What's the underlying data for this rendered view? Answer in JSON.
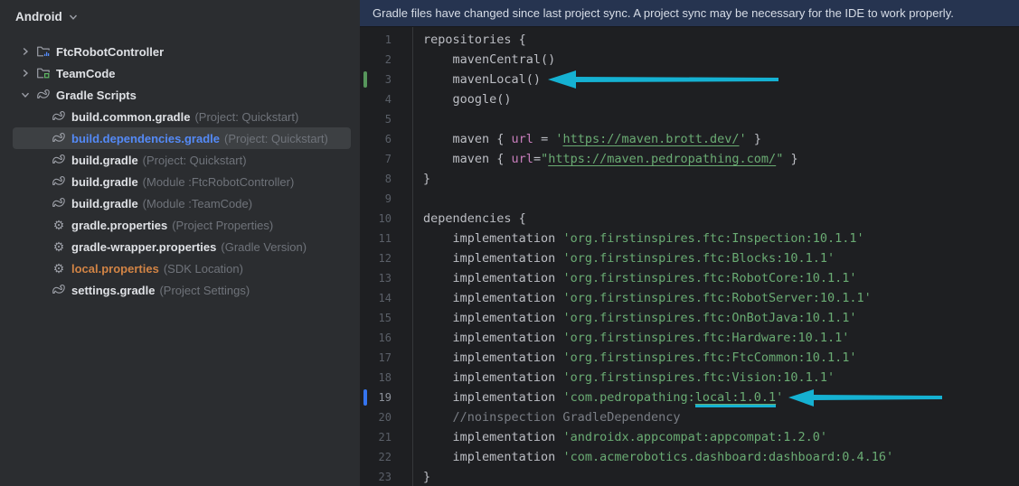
{
  "colors": {
    "accent_arrow": "#15b1d2",
    "banner_bg": "#263450",
    "selected_file": "#548af7",
    "sdk_location_file": "#d28445",
    "string_green": "#6aab73",
    "url_key_purple": "#c77dbb",
    "comment_gray": "#7a7e85",
    "added_marker_green": "#57965c",
    "changed_marker_blue": "#3574f0"
  },
  "sidebar": {
    "title": "Android",
    "items": [
      {
        "label": "FtcRobotController",
        "annotation": "",
        "icon": "android-folder",
        "chevron": "right",
        "level": 0,
        "selected": false,
        "color": ""
      },
      {
        "label": "TeamCode",
        "annotation": "",
        "icon": "code-folder",
        "chevron": "right",
        "level": 0,
        "selected": false,
        "color": ""
      },
      {
        "label": "Gradle Scripts",
        "annotation": "",
        "icon": "gradle",
        "chevron": "down",
        "level": 0,
        "selected": false,
        "color": ""
      },
      {
        "label": "build.common.gradle",
        "annotation": "(Project: Quickstart)",
        "icon": "gradle",
        "chevron": "",
        "level": 1,
        "selected": false,
        "color": ""
      },
      {
        "label": "build.dependencies.gradle",
        "annotation": "(Project: Quickstart)",
        "icon": "gradle",
        "chevron": "",
        "level": 1,
        "selected": true,
        "color": "blue"
      },
      {
        "label": "build.gradle",
        "annotation": "(Project: Quickstart)",
        "icon": "gradle",
        "chevron": "",
        "level": 1,
        "selected": false,
        "color": ""
      },
      {
        "label": "build.gradle",
        "annotation": "(Module :FtcRobotController)",
        "icon": "gradle",
        "chevron": "",
        "level": 1,
        "selected": false,
        "color": ""
      },
      {
        "label": "build.gradle",
        "annotation": "(Module :TeamCode)",
        "icon": "gradle",
        "chevron": "",
        "level": 1,
        "selected": false,
        "color": ""
      },
      {
        "label": "gradle.properties",
        "annotation": "(Project Properties)",
        "icon": "gear",
        "chevron": "",
        "level": 1,
        "selected": false,
        "color": ""
      },
      {
        "label": "gradle-wrapper.properties",
        "annotation": "(Gradle Version)",
        "icon": "gear",
        "chevron": "",
        "level": 1,
        "selected": false,
        "color": ""
      },
      {
        "label": "local.properties",
        "annotation": "(SDK Location)",
        "icon": "gear",
        "chevron": "",
        "level": 1,
        "selected": false,
        "color": "orange"
      },
      {
        "label": "settings.gradle",
        "annotation": "(Project Settings)",
        "icon": "gradle",
        "chevron": "",
        "level": 1,
        "selected": false,
        "color": ""
      }
    ]
  },
  "banner": {
    "text": "Gradle files have changed since last project sync. A project sync may be necessary for the IDE to work properly."
  },
  "editor": {
    "lines": [
      {
        "n": "1",
        "seg": [
          [
            "plain",
            "repositories {"
          ]
        ],
        "marker": "",
        "active": false
      },
      {
        "n": "2",
        "seg": [
          [
            "plain",
            "    mavenCentral()"
          ]
        ],
        "marker": "",
        "active": false
      },
      {
        "n": "3",
        "seg": [
          [
            "plain",
            "    mavenLocal()"
          ]
        ],
        "marker": "added",
        "active": false
      },
      {
        "n": "4",
        "seg": [
          [
            "plain",
            "    google()"
          ]
        ],
        "marker": "",
        "active": false
      },
      {
        "n": "5",
        "seg": [],
        "marker": "",
        "active": false
      },
      {
        "n": "6",
        "seg": [
          [
            "plain",
            "    maven { "
          ],
          [
            "prop",
            "url"
          ],
          [
            "plain",
            " = "
          ],
          [
            "string",
            "'"
          ],
          [
            "link",
            "https://maven.brott.dev/"
          ],
          [
            "string",
            "'"
          ],
          [
            "plain",
            " }"
          ]
        ],
        "marker": "",
        "active": false
      },
      {
        "n": "7",
        "seg": [
          [
            "plain",
            "    maven { "
          ],
          [
            "prop",
            "url"
          ],
          [
            "plain",
            "="
          ],
          [
            "string",
            "\""
          ],
          [
            "link",
            "https://maven.pedropathing.com/"
          ],
          [
            "string",
            "\""
          ],
          [
            "plain",
            " }"
          ]
        ],
        "marker": "",
        "active": false
      },
      {
        "n": "8",
        "seg": [
          [
            "plain",
            "}"
          ]
        ],
        "marker": "",
        "active": false
      },
      {
        "n": "9",
        "seg": [],
        "marker": "",
        "active": false
      },
      {
        "n": "10",
        "seg": [
          [
            "plain",
            "dependencies {"
          ]
        ],
        "marker": "",
        "active": false
      },
      {
        "n": "11",
        "seg": [
          [
            "plain",
            "    implementation "
          ],
          [
            "string",
            "'org.firstinspires.ftc:Inspection:10.1.1'"
          ]
        ],
        "marker": "",
        "active": false
      },
      {
        "n": "12",
        "seg": [
          [
            "plain",
            "    implementation "
          ],
          [
            "string",
            "'org.firstinspires.ftc:Blocks:10.1.1'"
          ]
        ],
        "marker": "",
        "active": false
      },
      {
        "n": "13",
        "seg": [
          [
            "plain",
            "    implementation "
          ],
          [
            "string",
            "'org.firstinspires.ftc:RobotCore:10.1.1'"
          ]
        ],
        "marker": "",
        "active": false
      },
      {
        "n": "14",
        "seg": [
          [
            "plain",
            "    implementation "
          ],
          [
            "string",
            "'org.firstinspires.ftc:RobotServer:10.1.1'"
          ]
        ],
        "marker": "",
        "active": false
      },
      {
        "n": "15",
        "seg": [
          [
            "plain",
            "    implementation "
          ],
          [
            "string",
            "'org.firstinspires.ftc:OnBotJava:10.1.1'"
          ]
        ],
        "marker": "",
        "active": false
      },
      {
        "n": "16",
        "seg": [
          [
            "plain",
            "    implementation "
          ],
          [
            "string",
            "'org.firstinspires.ftc:Hardware:10.1.1'"
          ]
        ],
        "marker": "",
        "active": false
      },
      {
        "n": "17",
        "seg": [
          [
            "plain",
            "    implementation "
          ],
          [
            "string",
            "'org.firstinspires.ftc:FtcCommon:10.1.1'"
          ]
        ],
        "marker": "",
        "active": false
      },
      {
        "n": "18",
        "seg": [
          [
            "plain",
            "    implementation "
          ],
          [
            "string",
            "'org.firstinspires.ftc:Vision:10.1.1'"
          ]
        ],
        "marker": "",
        "active": false
      },
      {
        "n": "19",
        "seg": [
          [
            "plain",
            "    implementation "
          ],
          [
            "string",
            "'com.pedropathing:"
          ],
          [
            "linkann",
            "local:1.0.1"
          ],
          [
            "string",
            "'"
          ]
        ],
        "marker": "changed",
        "active": true
      },
      {
        "n": "20",
        "seg": [
          [
            "comment",
            "    //noinspection GradleDependency"
          ]
        ],
        "marker": "",
        "active": false
      },
      {
        "n": "21",
        "seg": [
          [
            "plain",
            "    implementation "
          ],
          [
            "string",
            "'androidx.appcompat:appcompat:1.2.0'"
          ]
        ],
        "marker": "",
        "active": false
      },
      {
        "n": "22",
        "seg": [
          [
            "plain",
            "    implementation "
          ],
          [
            "string",
            "'com.acmerobotics.dashboard:dashboard:0.4.16'"
          ]
        ],
        "marker": "",
        "active": false
      },
      {
        "n": "23",
        "seg": [
          [
            "plain",
            "}"
          ]
        ],
        "marker": "",
        "active": false
      }
    ]
  },
  "annotations": {
    "arrow_1_points_to": "mavenLocal()",
    "arrow_2_points_to": "local:1.0.1"
  }
}
